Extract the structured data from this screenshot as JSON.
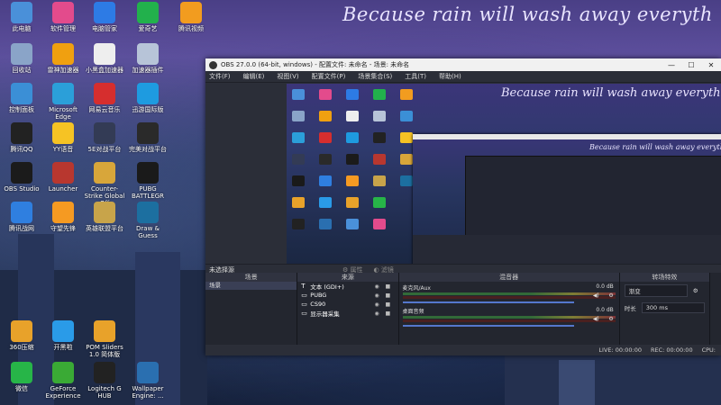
{
  "wallpaper": {
    "text": "Because rain will wash away everyth"
  },
  "desktop_icons": [
    {
      "label": "此电脑",
      "icon": "computer-icon",
      "color": "#4a90d9"
    },
    {
      "label": "软件管理",
      "icon": "app-manager-icon",
      "color": "#e34b8c"
    },
    {
      "label": "电脑管家",
      "icon": "shield-icon",
      "color": "#2d7be5"
    },
    {
      "label": "爱奇艺",
      "icon": "iqiyi-icon",
      "color": "#22b14c"
    },
    {
      "label": "腾讯视频",
      "icon": "tencent-video-icon",
      "color": "#f29c1f"
    },
    {
      "label": "回收站",
      "icon": "recycle-bin-icon",
      "color": "#8aa4c8"
    },
    {
      "label": "雷神加速器",
      "icon": "leishen-icon",
      "color": "#f0a010"
    },
    {
      "label": "小黑盒加速器",
      "icon": "xiaoheihe-icon",
      "color": "#eeeeee"
    },
    {
      "label": "加速器插件",
      "icon": "plugin-icon",
      "color": "#b7c4d8"
    },
    {
      "label": "控制面板",
      "icon": "control-panel-icon",
      "color": "#3b8fd6"
    },
    {
      "label": "Microsoft Edge",
      "icon": "edge-icon",
      "color": "#2b9fd9"
    },
    {
      "label": "网易云音乐",
      "icon": "netease-music-icon",
      "color": "#d62e2e"
    },
    {
      "label": "迅游国际版",
      "icon": "xunyou-icon",
      "color": "#1e9be0"
    },
    {
      "label": "腾讯QQ",
      "icon": "qq-icon",
      "color": "#222222"
    },
    {
      "label": "YY语音",
      "icon": "yy-icon",
      "color": "#f6c324"
    },
    {
      "label": "5E对战平台",
      "icon": "5e-icon",
      "color": "#333b55"
    },
    {
      "label": "完美对战平台",
      "icon": "perfect-icon",
      "color": "#2a2a2a"
    },
    {
      "label": "OBS Studio",
      "icon": "obs-icon",
      "color": "#1b1b1b"
    },
    {
      "label": "Launcher",
      "icon": "launcher-icon",
      "color": "#b8372f"
    },
    {
      "label": "Counter-Strike Global Off",
      "icon": "csgo-icon",
      "color": "#d8a63a"
    },
    {
      "label": "PUBG BATTLEGR",
      "icon": "pubg-icon",
      "color": "#1a1a1a"
    },
    {
      "label": "腾讯战网",
      "icon": "tencent-battle-icon",
      "color": "#2f7fe0"
    },
    {
      "label": "守望先锋",
      "icon": "overwatch-icon",
      "color": "#f59a22"
    },
    {
      "label": "英雄联盟平台",
      "icon": "lol-icon",
      "color": "#c8a44a"
    },
    {
      "label": "Draw & Guess",
      "icon": "draw-guess-icon",
      "color": "#1c6fa0"
    },
    {
      "label": "360压缩",
      "icon": "zip-icon",
      "color": "#e8a22a"
    },
    {
      "label": "开黑啦",
      "icon": "kaiheila-icon",
      "color": "#2a9be8"
    },
    {
      "label": "POM Sliders 1.0 简体版",
      "icon": "pom-icon",
      "color": "#e8a22a"
    },
    {
      "label": "微信",
      "icon": "wechat-icon",
      "color": "#27b548"
    },
    {
      "label": "GeForce Experience",
      "icon": "nvidia-icon",
      "color": "#3aaa35"
    },
    {
      "label": "Logitech G HUB",
      "icon": "logitech-icon",
      "color": "#222222"
    },
    {
      "label": "Wallpaper Engine: ...",
      "icon": "wallpaper-engine-icon",
      "color": "#2a6fb0"
    }
  ],
  "obs": {
    "title": "OBS 27.0.0 (64-bit, windows) - 配置文件: 未命名 - 场景: 未命名",
    "menu": [
      "文件(F)",
      "编辑(E)",
      "视图(V)",
      "配置文件(P)",
      "场景集合(S)",
      "工具(T)",
      "帮助(H)"
    ],
    "preview_text": "Because rain will wash away everyth",
    "nested_text": "Because rain will wash away everything",
    "no_source_selected": "未选择源",
    "properties_label": "属性",
    "filters_label": "滤镜",
    "scenes": {
      "header": "场景",
      "items": [
        "场景"
      ]
    },
    "sources": {
      "header": "来源",
      "items": [
        {
          "icon": "text-icon",
          "glyph": "T",
          "label": "文本 (GDI+)"
        },
        {
          "icon": "window-icon",
          "glyph": "▭",
          "label": "PUBG"
        },
        {
          "icon": "window-icon",
          "glyph": "▭",
          "label": "CS90"
        },
        {
          "icon": "monitor-icon",
          "glyph": "▭",
          "label": "显示器采集"
        }
      ]
    },
    "mixer": {
      "header": "混音器",
      "tracks": [
        {
          "name": "麦克风/Aux",
          "db": "0.0 dB"
        },
        {
          "name": "桌面音频",
          "db": "0.0 dB"
        }
      ]
    },
    "transitions": {
      "header": "转场特效",
      "type": "渐变",
      "duration_label": "时长",
      "duration": "300 ms"
    },
    "status": {
      "live": "LIVE: 00:00:00",
      "rec": "REC: 00:00:00",
      "cpu": "CPU:"
    }
  },
  "colors": {
    "obs_bg": "#2b2e38",
    "dock_bg": "#23262f"
  }
}
